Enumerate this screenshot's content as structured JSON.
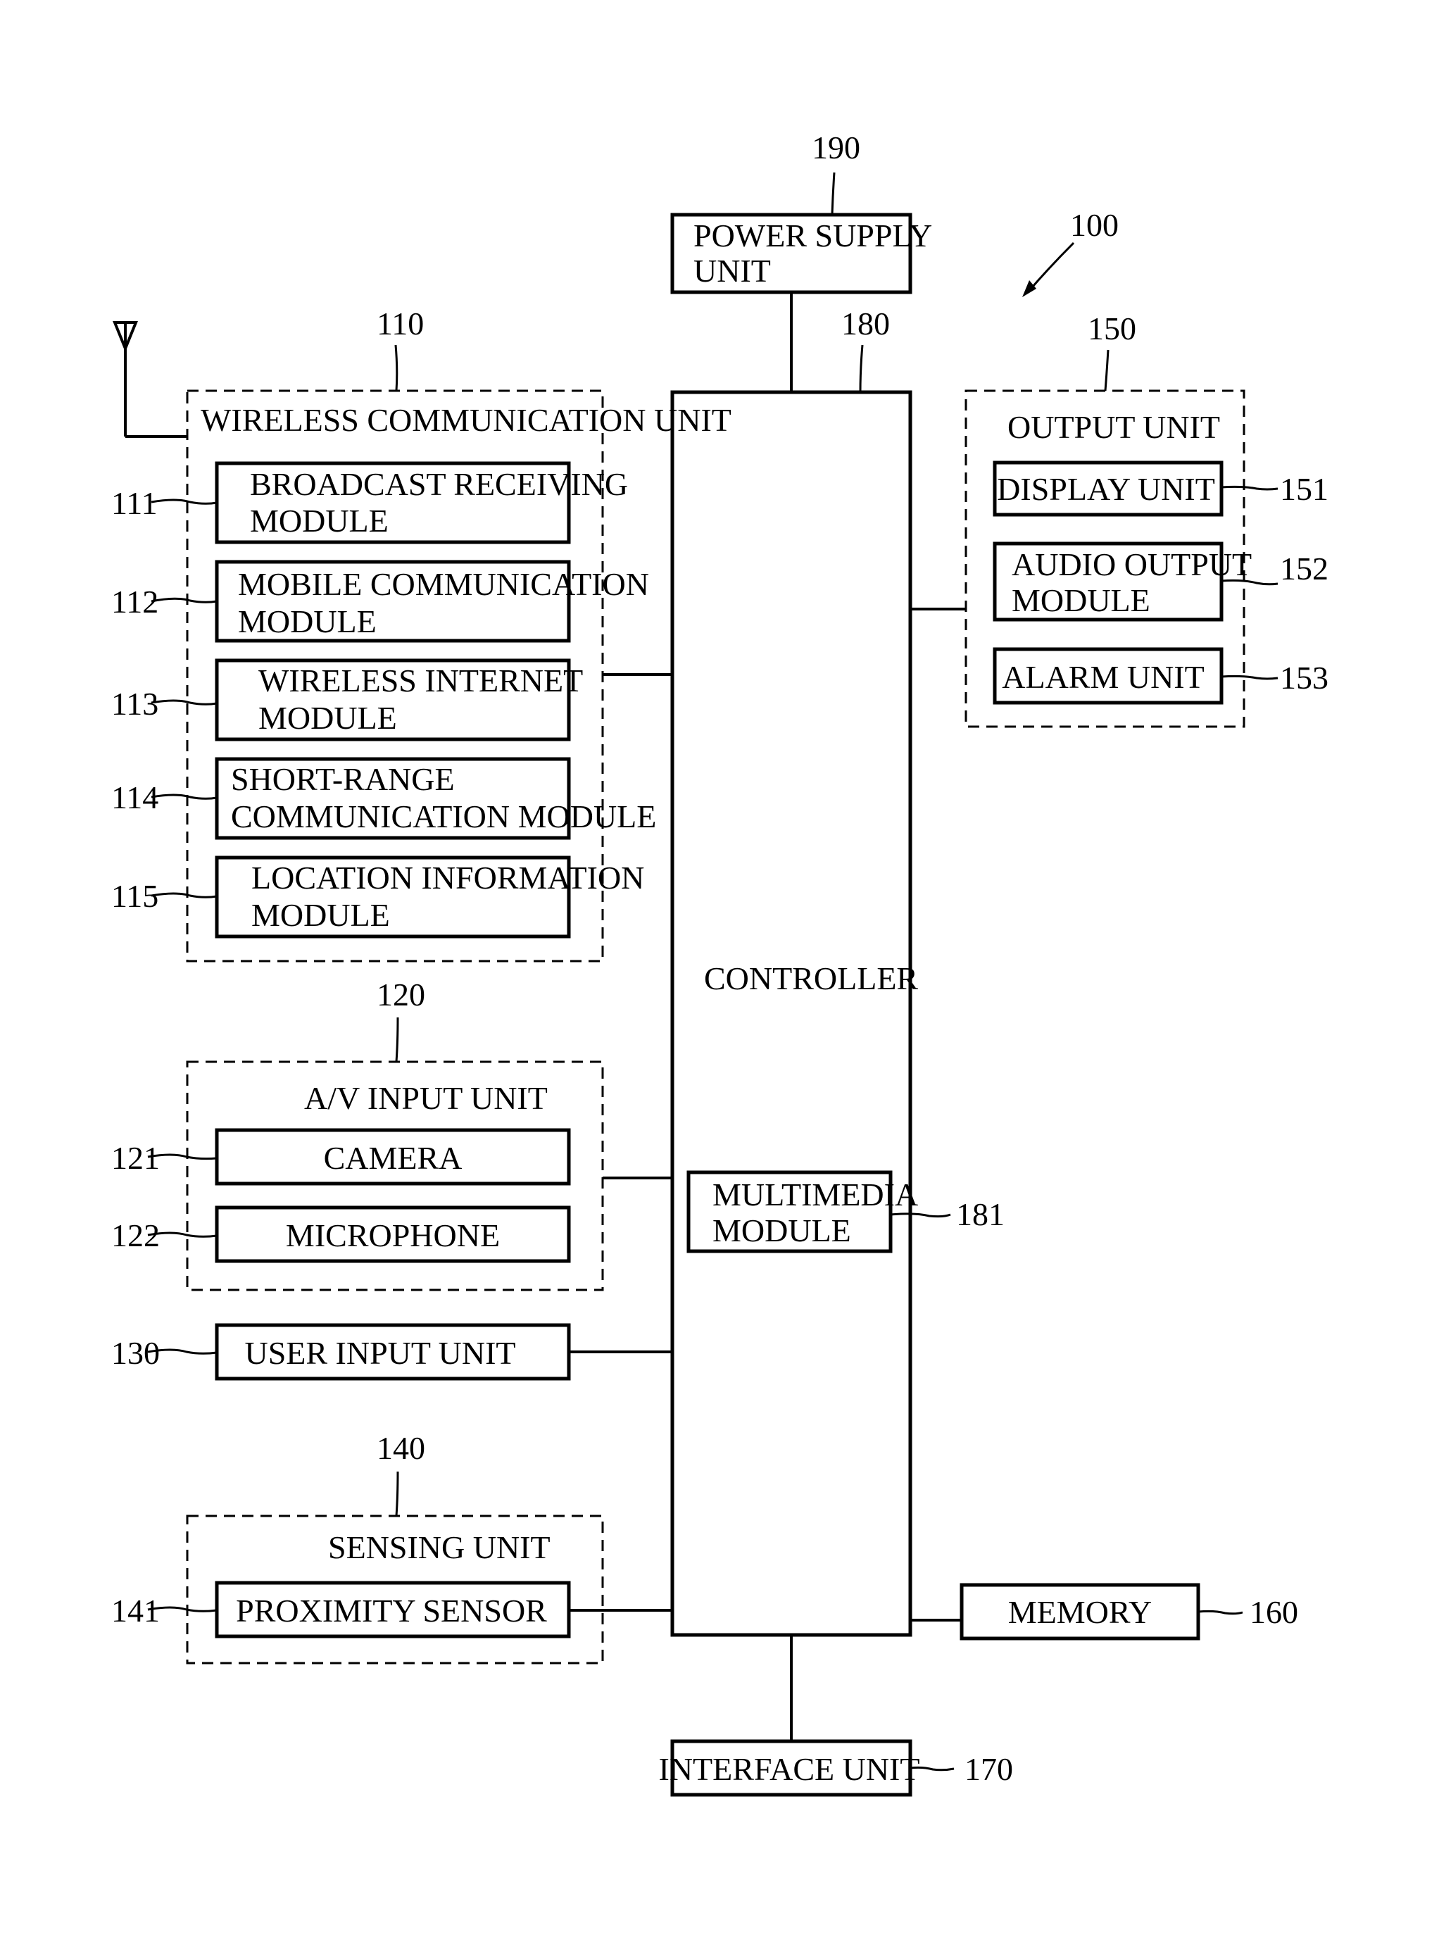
{
  "figure": {
    "ref": "100",
    "color_ink": "#000000",
    "color_paper": "#ffffff"
  },
  "antenna": {
    "icon": "antenna-icon"
  },
  "power_supply": {
    "ref": "190",
    "lines": [
      "POWER SUPPLY",
      "UNIT"
    ]
  },
  "controller": {
    "ref": "180",
    "label": "CONTROLLER",
    "multimedia": {
      "ref": "181",
      "lines": [
        "MULTIMEDIA",
        "MODULE"
      ]
    }
  },
  "wireless": {
    "ref": "110",
    "title": "WIRELESS COMMUNICATION UNIT",
    "modules": [
      {
        "ref": "111",
        "lines": [
          "BROADCAST RECEIVING",
          "MODULE"
        ]
      },
      {
        "ref": "112",
        "lines": [
          "MOBILE COMMUNICATION",
          "MODULE"
        ]
      },
      {
        "ref": "113",
        "lines": [
          "WIRELESS INTERNET",
          "MODULE"
        ]
      },
      {
        "ref": "114",
        "lines": [
          "SHORT-RANGE",
          "COMMUNICATION MODULE"
        ]
      },
      {
        "ref": "115",
        "lines": [
          "LOCATION INFORMATION",
          "MODULE"
        ]
      }
    ]
  },
  "av_input": {
    "ref": "120",
    "title": "A/V INPUT UNIT",
    "modules": [
      {
        "ref": "121",
        "label": "CAMERA"
      },
      {
        "ref": "122",
        "label": "MICROPHONE"
      }
    ]
  },
  "user_input": {
    "ref": "130",
    "label": "USER INPUT UNIT"
  },
  "sensing": {
    "ref": "140",
    "title": "SENSING UNIT",
    "modules": [
      {
        "ref": "141",
        "label": "PROXIMITY SENSOR"
      }
    ]
  },
  "output": {
    "ref": "150",
    "title": "OUTPUT UNIT",
    "modules": [
      {
        "ref": "151",
        "lines": [
          "DISPLAY UNIT"
        ]
      },
      {
        "ref": "152",
        "lines": [
          "AUDIO OUTPUT",
          "MODULE"
        ]
      },
      {
        "ref": "153",
        "lines": [
          "ALARM UNIT"
        ]
      }
    ]
  },
  "memory": {
    "ref": "160",
    "label": "MEMORY"
  },
  "interface": {
    "ref": "170",
    "label": "INTERFACE UNIT"
  }
}
